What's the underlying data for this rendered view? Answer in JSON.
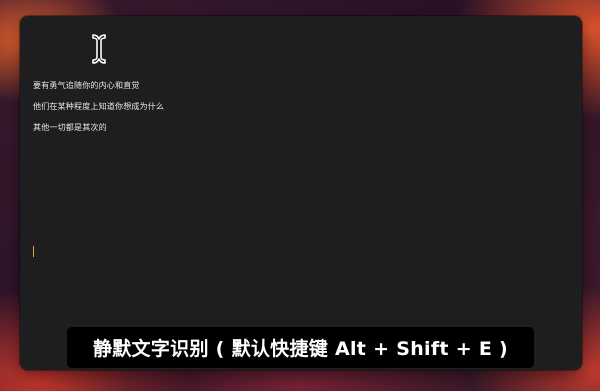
{
  "editor": {
    "lines": [
      "要有勇气追随你的内心和直觉",
      "他们在某种程度上知道你想成为什么",
      "其他一切都是其次的"
    ]
  },
  "caption": {
    "text": "静默文字识别 ( 默认快捷键 Alt + Shift + E )"
  },
  "icons": {
    "cursor": "text-ibeam-cursor-icon"
  },
  "colors": {
    "editor_background": "#1e1e20",
    "text": "#e8e8e8",
    "caret": "#d7a04a",
    "caption_background": "#000000"
  }
}
